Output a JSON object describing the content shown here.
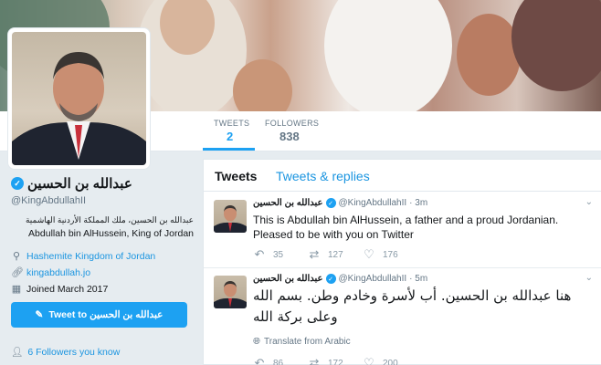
{
  "profile": {
    "display_name": "عبدالله بن الحسين",
    "handle": "@KingAbdullahII",
    "bio_arabic": "عبدالله بن الحسين، ملك المملكة الأردنية الهاشمية",
    "bio_english": "Abdullah bin AlHussein, King of Jordan",
    "location": "Hashemite Kingdom of Jordan",
    "website": "kingabdullah.jo",
    "joined": "Joined March 2017",
    "tweet_to_label": "Tweet to عبدالله بن الحسين",
    "followers_you_know": "6 Followers you know"
  },
  "stats": {
    "tweets_label": "TWEETS",
    "tweets_value": "2",
    "followers_label": "FOLLOWERS",
    "followers_value": "838"
  },
  "timeline": {
    "tabs": [
      "Tweets",
      "Tweets & replies"
    ],
    "tweets": [
      {
        "name": "عبدالله بن الحسين",
        "handle": "@KingAbdullahII",
        "time": "· 3m",
        "text": "This is Abdullah bin AlHussein, a father and a proud Jordanian. Pleased to be with you on Twitter",
        "replies": "35",
        "retweets": "127",
        "likes": "176"
      },
      {
        "name": "عبدالله بن الحسين",
        "handle": "@KingAbdullahII",
        "time": "· 5m",
        "text": "هنا عبدالله بن الحسين. أب لأسرة وخادم وطن. بسم الله وعلى بركة الله",
        "translate_label": "Translate from Arabic",
        "replies": "86",
        "retweets": "172",
        "likes": "200"
      }
    ]
  },
  "colors": {
    "accent": "#1da1f2",
    "link": "#1b95e0",
    "muted": "#657786",
    "background": "#e6ecf0"
  }
}
